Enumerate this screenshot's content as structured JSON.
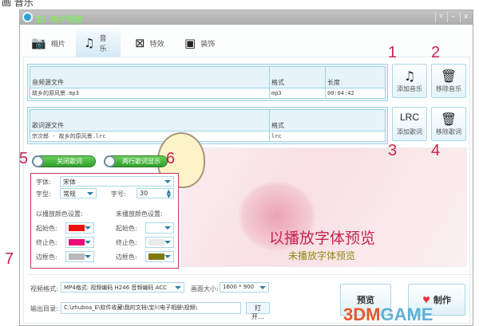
{
  "page_heading_fragment": "画 音乐",
  "window": {
    "title": "宝川电子相册",
    "controls": [
      "▿",
      "–",
      "x"
    ]
  },
  "tabs": [
    {
      "label": "相片",
      "icon": "camera-icon"
    },
    {
      "label": "音乐",
      "icon": "music-icon",
      "selected": true
    },
    {
      "label": "特效",
      "icon": "effects-icon"
    },
    {
      "label": "装饰",
      "icon": "picture-icon"
    }
  ],
  "audio_table": {
    "headers": [
      "音频源文件",
      "格式",
      "长度"
    ],
    "rows": [
      [
        "故乡的原风景.mp3",
        "mp3",
        "00:04:42"
      ]
    ]
  },
  "lyrics_table": {
    "headers": [
      "歌词源文件",
      "格式"
    ],
    "rows": [
      [
        "宗次郎 - 故乡的原风景.lrc",
        "lrc"
      ]
    ]
  },
  "buttons": {
    "add_music": "添加音乐",
    "remove_music": "移除音乐",
    "add_lyrics": "添加歌词",
    "remove_lyrics": "移除歌词",
    "lrc_icon": "LRC",
    "preview": "预览",
    "make": "制作",
    "open": "打开…"
  },
  "annotations": [
    "1",
    "2",
    "3",
    "4",
    "5",
    "6",
    "7"
  ],
  "toggles": {
    "close_lyrics": "关闭歌词",
    "two_line": "两行歌词显示"
  },
  "font_settings": {
    "font_label": "字体:",
    "font_value": "宋体",
    "style_label": "字型:",
    "style_value": "常规",
    "size_label": "字号:",
    "size_value": "30",
    "played_title": "以播放颜色设置:",
    "unplayed_title": "未播放颜色设置:",
    "start_label": "起始色:",
    "end_label": "终止色:",
    "border_label": "边框色:",
    "played_colors": {
      "start": "#ee1111",
      "end": "#ee0a78",
      "border": "#b9b9b9"
    },
    "unplayed_colors": {
      "start": "#ffffff",
      "end": "#e8eaea",
      "border": "#7d7a10"
    }
  },
  "preview": {
    "played_text": "以播放字体预览",
    "unplayed_text": "未播放字体预览"
  },
  "output": {
    "format_label": "视频格式:",
    "format_value": "MP4格式: 视频编码 H246 音频编码 ACC",
    "size_label": "画面大小:",
    "size_value": "1600 * 900",
    "dir_label": "输出目录:",
    "dir_value": "C:\\zhuboa_E\\软件收藏\\我的文档\\宝川电子相册\\视频\\"
  },
  "watermark": {
    "a": "3DM",
    "b": "GAME"
  }
}
